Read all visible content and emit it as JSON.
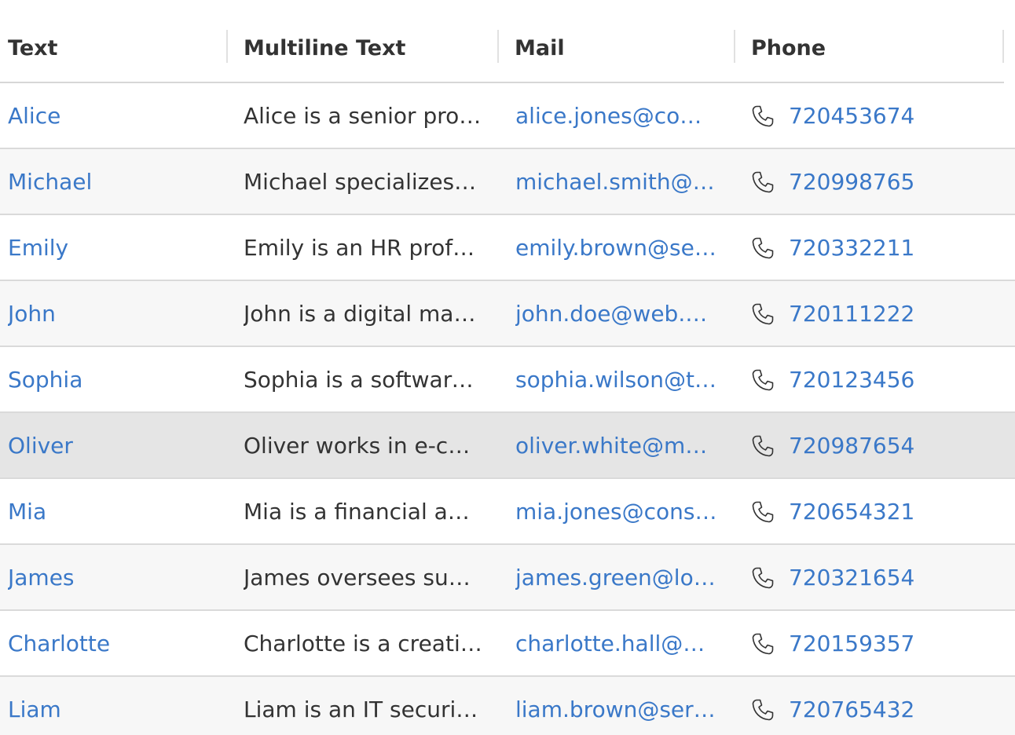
{
  "colors": {
    "link": "#3a78c8",
    "text": "#333333",
    "row_alt": "#f7f7f7",
    "row_selected": "#e5e5e5"
  },
  "columns": {
    "text": "Text",
    "multiline": "Multiline Text",
    "mail": "Mail",
    "phone": "Phone"
  },
  "rows": [
    {
      "name": "Alice",
      "description": "Alice is a senior project…",
      "email": "alice.jones@compa…",
      "phone": "720453674"
    },
    {
      "name": "Michael",
      "description": "Michael specializes in …",
      "email": "michael.smith@do…",
      "phone": "720998765"
    },
    {
      "name": "Emily",
      "description": "Emily is an HR professi…",
      "email": "emily.brown@servi…",
      "phone": "720332211"
    },
    {
      "name": "John",
      "description": "John is a digital market…",
      "email": "john.doe@web.com",
      "phone": "720111222"
    },
    {
      "name": "Sophia",
      "description": "Sophia is a software de…",
      "email": "sophia.wilson@tec…",
      "phone": "720123456"
    },
    {
      "name": "Oliver",
      "description": "Oliver works in e-com…",
      "email": "oliver.white@mark…",
      "phone": "720987654"
    },
    {
      "name": "Mia",
      "description": "Mia is a financial analy…",
      "email": "mia.jones@consult…",
      "phone": "720654321"
    },
    {
      "name": "James",
      "description": "James oversees supply…",
      "email": "james.green@logis…",
      "phone": "720321654"
    },
    {
      "name": "Charlotte",
      "description": "Charlotte is a creative …",
      "email": "charlotte.hall@age…",
      "phone": "720159357"
    },
    {
      "name": "Liam",
      "description": "Liam is an IT security s…",
      "email": "liam.brown@servic…",
      "phone": "720765432"
    }
  ]
}
